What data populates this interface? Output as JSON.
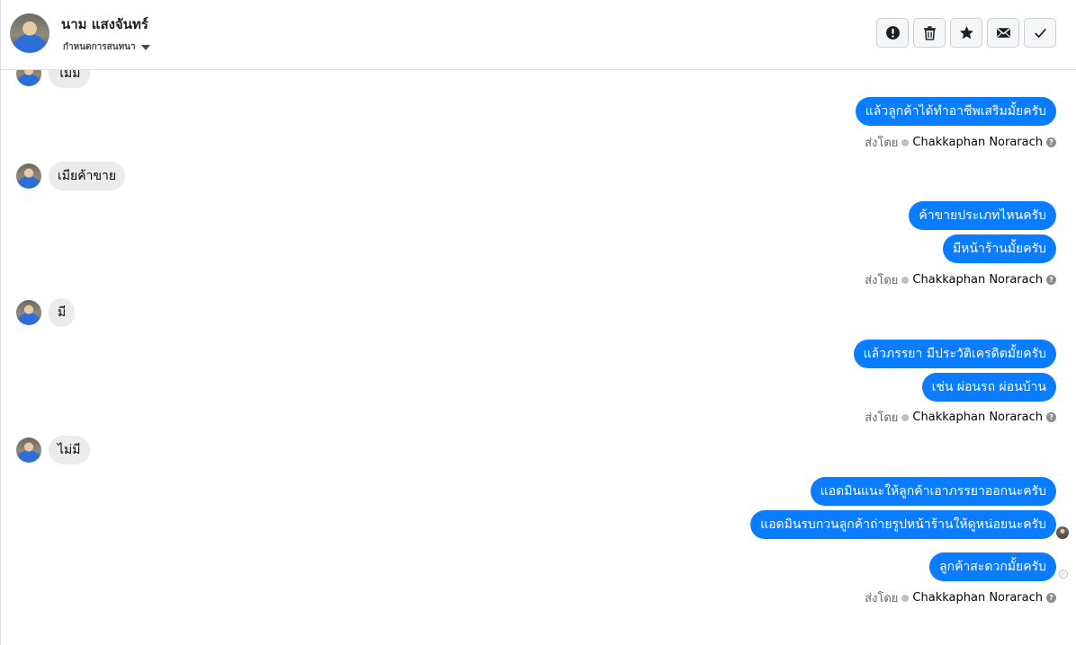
{
  "header": {
    "contact_name": "นาม แสงจันทร์",
    "assign_label": "กำหนดการสนทนา",
    "actions": [
      {
        "name": "spam-button",
        "icon": "alert-circle-icon"
      },
      {
        "name": "delete-button",
        "icon": "trash-icon"
      },
      {
        "name": "star-button",
        "icon": "star-icon"
      },
      {
        "name": "mark-unread-button",
        "icon": "envelope-icon"
      },
      {
        "name": "mark-done-button",
        "icon": "checkmark-icon"
      }
    ]
  },
  "messages": {
    "in_0": "ไม่มี",
    "out_1": "แล้วลูกค้าได้ทำอาชีพเสริมมั้ยครับ",
    "sent_1": {
      "prefix": "ส่งโดย",
      "agent": "Chakkaphan Norarach"
    },
    "in_2": "เมียค้าขาย",
    "out_3": "ค้าขายประเภทไหนครับ",
    "out_4": "มีหน้าร้านมั้ยครับ",
    "sent_2": {
      "prefix": "ส่งโดย",
      "agent": "Chakkaphan Norarach"
    },
    "in_5": "มี",
    "out_6": "แล้วภรรยา มีประวัติเครดิตมั้ยครับ",
    "out_7": "เช่น ผ่อนรถ ผ่อนบ้าน",
    "sent_3": {
      "prefix": "ส่งโดย",
      "agent": "Chakkaphan Norarach"
    },
    "in_8": "ไม่มี",
    "out_9": "แอดมินแนะให้ลูกค้าเอาภรรยาออกนะครับ",
    "out_10": "แอดมินรบกวนลูกค้าถ่ายรูปหน้าร้านให้ดูหน่อยนะครับ",
    "out_11": "ลูกค้าสะดวกมั้ยครับ",
    "sent_4": {
      "prefix": "ส่งโดย",
      "agent": "Chakkaphan Norarach"
    }
  },
  "colors": {
    "outgoing_bubble": "#0a7cff",
    "incoming_bubble": "#ebebeb",
    "border": "#dadde1"
  }
}
